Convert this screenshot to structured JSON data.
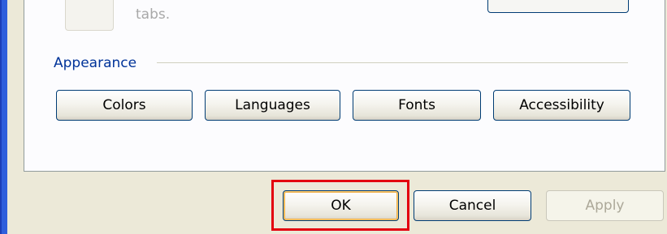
{
  "window": {
    "partial_text": "tabs."
  },
  "appearance": {
    "group_label": "Appearance",
    "buttons": {
      "colors": "Colors",
      "languages": "Languages",
      "fonts": "Fonts",
      "accessibility": "Accessibility"
    }
  },
  "footer": {
    "ok": "OK",
    "cancel": "Cancel",
    "apply": "Apply",
    "apply_enabled": false
  },
  "highlight": {
    "target": "ok",
    "color": "#e3000f"
  },
  "colors": {
    "dialog_background": "#ece9d8",
    "panel_background": "#fcfcfe",
    "group_label": "#003399",
    "button_border": "#003c74"
  }
}
